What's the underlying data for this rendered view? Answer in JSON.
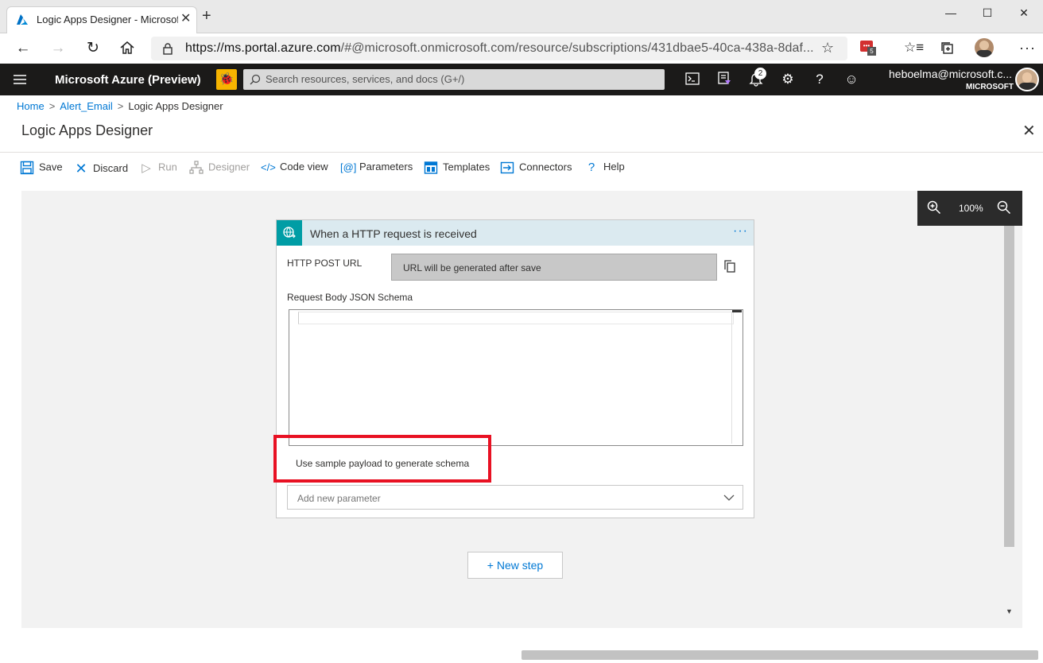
{
  "browser": {
    "tab_title": "Logic Apps Designer - Microsoft",
    "tab_close": "✕",
    "new_tab": "+",
    "url_host": "https://ms.portal.azure.com",
    "url_rest": "/#@microsoft.onmicrosoft.com/resource/subscriptions/431dbae5-40ca-438a-8daf...",
    "extension_badge": "5",
    "window_controls": {
      "minimize": "—",
      "maximize": "☐",
      "close": "✕"
    }
  },
  "azure_header": {
    "brand": "Microsoft Azure (Preview)",
    "search_placeholder": "Search resources, services, and docs (G+/)",
    "notification_count": "2",
    "user_email": "heboelma@microsoft.c...",
    "user_tenant": "MICROSOFT"
  },
  "breadcrumb": {
    "items": [
      "Home",
      "Alert_Email",
      "Logic Apps Designer"
    ]
  },
  "blade": {
    "title": "Logic Apps Designer",
    "close": "✕"
  },
  "commands": {
    "save": "Save",
    "discard": "Discard",
    "run": "Run",
    "designer": "Designer",
    "code_view": "Code view",
    "parameters": "Parameters",
    "templates": "Templates",
    "connectors": "Connectors",
    "help": "Help"
  },
  "zoom": {
    "level": "100%"
  },
  "trigger_card": {
    "title": "When a HTTP request is received",
    "menu": "···",
    "http_post_url_label": "HTTP POST URL",
    "http_post_url_value": "URL will be generated after save",
    "schema_label": "Request Body JSON Schema",
    "sample_payload_link": "Use sample payload to generate schema",
    "add_parameter_placeholder": "Add new parameter"
  },
  "new_step_button": "+ New step",
  "colors": {
    "azure_header_bg": "#1b1a19",
    "accent": "#0078d4",
    "trigger_icon_bg": "#009da5",
    "highlight": "#e81123"
  }
}
